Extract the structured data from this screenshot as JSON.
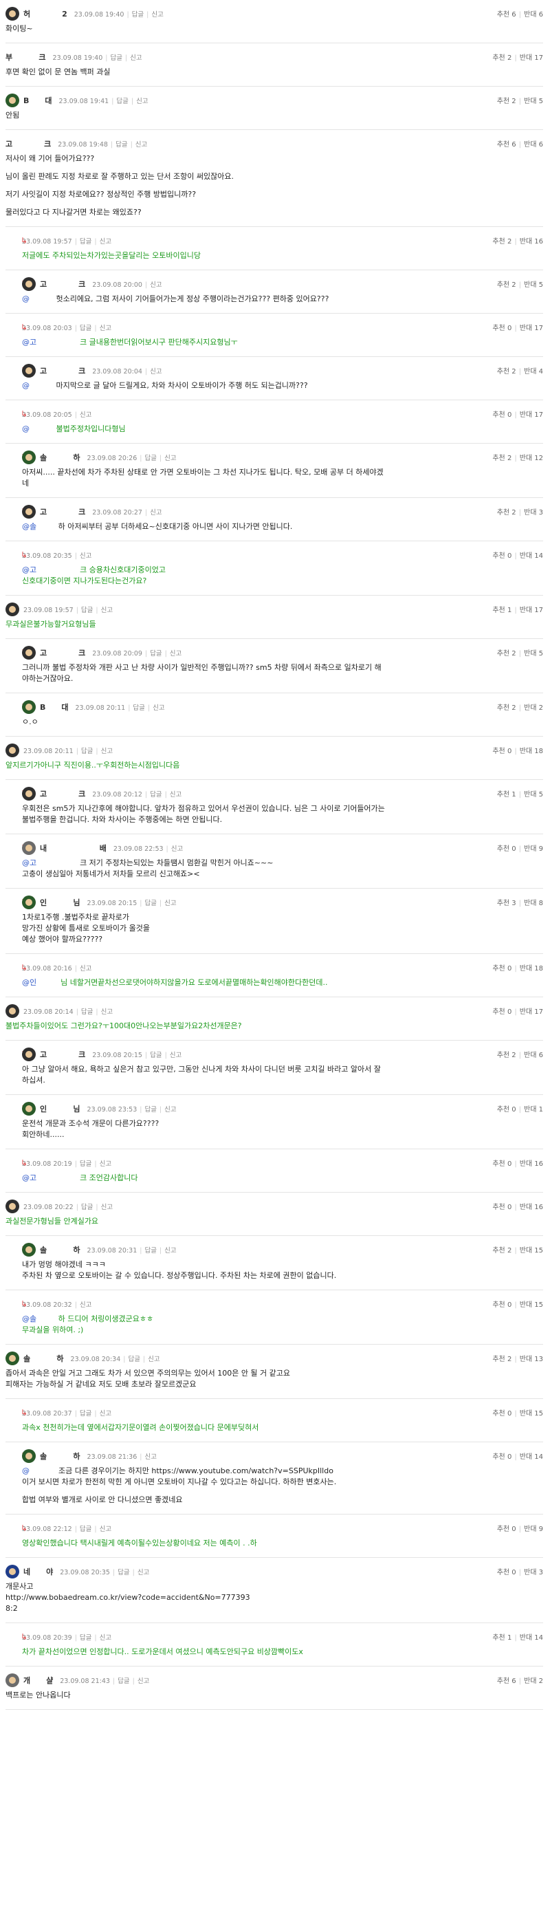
{
  "labels": {
    "reply": "답글",
    "report": "신고",
    "up": "추천",
    "down": "반대"
  },
  "comments": [
    {
      "id": 0,
      "reply": false,
      "avatar": "a1",
      "nick": "허            2",
      "date": "23.09.08 19:40",
      "links": [
        "답글",
        "신고"
      ],
      "up": "추천 6",
      "down": "반대 6",
      "lines": [
        "화이팅~"
      ]
    },
    {
      "id": 1,
      "reply": false,
      "avatar": "none",
      "nick": "부          크",
      "date": "23.09.08 19:40",
      "links": [
        "답글",
        "신고"
      ],
      "up": "추천 2",
      "down": "반대 17",
      "lines": [
        "후면 확인 없이 문 연놈 백퍼 과실"
      ]
    },
    {
      "id": 2,
      "reply": false,
      "avatar": "a2",
      "nick": "B      대",
      "date": "23.09.08 19:41",
      "links": [
        "답글",
        "신고"
      ],
      "up": "추천 2",
      "down": "반대 5",
      "lines": [
        "안됨"
      ]
    },
    {
      "id": 3,
      "reply": false,
      "avatar": "none",
      "nick": "고            크",
      "date": "23.09.08 19:48",
      "links": [
        "답글",
        "신고"
      ],
      "up": "추천 6",
      "down": "반대 6",
      "lines": [
        "저사이 왜 기어 들어가요???",
        "",
        "님이 올린 판례도 지정 차로로 잘 주행하고 있는 단서 조항이 써있잖아요.",
        "",
        "저기 사잇길이 지정 차로에요?? 정상적인 주행 방법입니까??",
        "",
        "물러있다고 다 지나갈거면 차로는 왜있죠??"
      ]
    },
    {
      "id": 4,
      "reply": true,
      "avatar": "none",
      "nick": "",
      "date": "23.09.08 19:57",
      "links": [
        "답글",
        "신고"
      ],
      "up": "추천 2",
      "down": "반대 16",
      "color": "green",
      "lines": [
        "저글에도 주차되있는차가있는곳을달리는 오토바이입니당"
      ]
    },
    {
      "id": 5,
      "reply": true,
      "avatar": "a1",
      "nick": "고            크",
      "date": "23.09.08 20:00",
      "links": [
        "신고"
      ],
      "up": "추천 2",
      "down": "반대 5",
      "mention": "@",
      "lines": [
        "           헛소리에요, 그럼 저사이 기어들어가는게 정상 주행이라는건가요??? 편하중 있어요???"
      ]
    },
    {
      "id": 6,
      "reply": true,
      "avatar": "none",
      "nick": "",
      "date": "23.09.08 20:03",
      "links": [
        "답글",
        "신고"
      ],
      "up": "추천 0",
      "down": "반대 17",
      "color": "green",
      "mention": "@고",
      "lines": [
        "                  크 글내용한번더읽어보시구 판단해주시지요형님ㅜ"
      ]
    },
    {
      "id": 7,
      "reply": true,
      "avatar": "a1",
      "nick": "고            크",
      "date": "23.09.08 20:04",
      "links": [
        "신고"
      ],
      "up": "추천 2",
      "down": "반대 4",
      "mention": "@",
      "lines": [
        "           마지막으로 글 달아 드릴게요, 차와 차사이 오토바이가 주행 허도 되는겁니까???"
      ]
    },
    {
      "id": 8,
      "reply": true,
      "avatar": "none",
      "nick": "",
      "date": "23.09.08 20:05",
      "links": [
        "신고"
      ],
      "up": "추천 0",
      "down": "반대 17",
      "color": "green",
      "mention": "@",
      "lines": [
        "           불법주정차입니다형님"
      ]
    },
    {
      "id": 9,
      "reply": true,
      "avatar": "a2",
      "nick": "솔          하",
      "date": "23.09.08 20:26",
      "links": [
        "답글",
        "신고"
      ],
      "up": "추천 2",
      "down": "반대 12",
      "lines": [
        "아저씨..... 끝차선에 차가 주차된 상태로 안 가면 오토바이는 그 차선 지나가도 됩니다. 탁오, 모배 공부 더 하세야겠",
        "네"
      ]
    },
    {
      "id": 10,
      "reply": true,
      "avatar": "a1",
      "nick": "고            크",
      "date": "23.09.08 20:27",
      "links": [
        "신고"
      ],
      "up": "추천 2",
      "down": "반대 3",
      "mention": "@솔",
      "lines": [
        "         하 아저씨부터 공부 더하세요~신호대기중 아니면 사이 지나가면 안됩니다."
      ]
    },
    {
      "id": 11,
      "reply": true,
      "avatar": "none",
      "nick": "",
      "date": "23.09.08 20:35",
      "links": [
        "신고"
      ],
      "up": "추천 0",
      "down": "반대 14",
      "color": "green",
      "mention": "@고",
      "lines": [
        "                  크 승용차신호대기중이었고",
        "신호대기중이면 지나가도된다는건가요?"
      ]
    },
    {
      "id": 12,
      "reply": false,
      "avatar": "a1",
      "nick": "",
      "date": "23.09.08 19:57",
      "links": [
        "답글",
        "신고"
      ],
      "up": "추천 1",
      "down": "반대 17",
      "color": "green",
      "lines": [
        "무과실은불가능할거요형님들"
      ]
    },
    {
      "id": 13,
      "reply": true,
      "avatar": "a1",
      "nick": "고            크",
      "date": "23.09.08 20:09",
      "links": [
        "답글",
        "신고"
      ],
      "up": "추천 2",
      "down": "반대 5",
      "lines": [
        "그러니까 불법 주정차와 개판 사고 난 차량 사이가 일반적인 주행입니까?? sm5 차량 뒤에서 좌측으로 일차로기 해",
        "야하는거잖아요."
      ]
    },
    {
      "id": 14,
      "reply": true,
      "avatar": "a2",
      "nick": "B      대",
      "date": "23.09.08 20:11",
      "links": [
        "답글",
        "신고"
      ],
      "up": "추천 2",
      "down": "반대 2",
      "lines": [
        "ㅇ.ㅇ"
      ]
    },
    {
      "id": 15,
      "reply": false,
      "avatar": "a1",
      "nick": "",
      "date": "23.09.08 20:11",
      "links": [
        "답글",
        "신고"
      ],
      "up": "추천 0",
      "down": "반대 18",
      "color": "green",
      "lines": [
        "앞지르기가아니구 직진이용..ㅜ우회전하는시점입니다음"
      ]
    },
    {
      "id": 16,
      "reply": true,
      "avatar": "a1",
      "nick": "고            크",
      "date": "23.09.08 20:12",
      "links": [
        "답글",
        "신고"
      ],
      "up": "추천 1",
      "down": "반대 5",
      "lines": [
        "우회전은 sm5가 지나간후에 해야합니다. 앞차가 점유하고 있어서 우선권이 있습니다. 님은 그 사이로 기어들어가는",
        "불법주행을 한겁니다. 차와 차사이는 주행중에는 하면 안됩니다."
      ]
    },
    {
      "id": 17,
      "reply": true,
      "avatar": "a4",
      "nick": "내                    배",
      "date": "23.09.08 22:53",
      "links": [
        "신고"
      ],
      "up": "추천 0",
      "down": "반대 9",
      "mention": "@고",
      "lines": [
        "                  크 저기 주정차는되있는 차들땜시 멈환길 막힌거 아니죠~~~",
        "고충이 생심일아 저통네가서 저차들 모르리 신고해죠><"
      ]
    },
    {
      "id": 18,
      "reply": true,
      "avatar": "a2",
      "nick": "인          님",
      "date": "23.09.08 20:15",
      "links": [
        "답글",
        "신고"
      ],
      "up": "추천 3",
      "down": "반대 8",
      "lines": [
        "1차로1주행 .불법주차로 끝차로가",
        "망가진 상황에 틈새로 오토바이가 올것을",
        "예상 했어야 할까요?????"
      ]
    },
    {
      "id": 19,
      "reply": true,
      "avatar": "none",
      "nick": "",
      "date": "23.09.08 20:16",
      "links": [
        "신고"
      ],
      "up": "추천 0",
      "down": "반대 18",
      "color": "green",
      "mention": "@인",
      "lines": [
        "          님 네할거면끝차선으로댓어야하지않을가요 도로에서끝멸매하는확인해야한다한던데.."
      ]
    },
    {
      "id": 20,
      "reply": false,
      "avatar": "a1",
      "nick": "",
      "date": "23.09.08 20:14",
      "links": [
        "답글",
        "신고"
      ],
      "up": "추천 0",
      "down": "반대 17",
      "color": "green",
      "lines": [
        "불법주차들이있어도 그런가요?ㅜ100대0안나오는부분일가요2차선개문은?"
      ]
    },
    {
      "id": 21,
      "reply": true,
      "avatar": "a1",
      "nick": "고            크",
      "date": "23.09.08 20:15",
      "links": [
        "답글",
        "신고"
      ],
      "up": "추천 2",
      "down": "반대 6",
      "lines": [
        "아 그냥 알아서 해요, 욕하고 싶은거 참고 있구만, 그동안 신나게 차와 차사이 다니던 버릇 고치길 바라고 알아서 잘",
        "하십셔."
      ]
    },
    {
      "id": 22,
      "reply": true,
      "avatar": "a2",
      "nick": "인          님",
      "date": "23.09.08 23:53",
      "links": [
        "답글",
        "신고"
      ],
      "up": "추천 0",
      "down": "반대 1",
      "lines": [
        "운전석 개문과 조수석 개문이 다른가요????",
        "회안하네......"
      ]
    },
    {
      "id": 23,
      "reply": true,
      "avatar": "none",
      "nick": "",
      "date": "23.09.08 20:19",
      "links": [
        "답글",
        "신고"
      ],
      "up": "추천 0",
      "down": "반대 16",
      "color": "green",
      "mention": "@고",
      "lines": [
        "                  크 조언감사합니다"
      ]
    },
    {
      "id": 24,
      "reply": false,
      "avatar": "a1",
      "nick": "",
      "date": "23.09.08 20:22",
      "links": [
        "답글",
        "신고"
      ],
      "up": "추천 0",
      "down": "반대 16",
      "color": "green",
      "lines": [
        "과실전문가형님들 안계실가요"
      ]
    },
    {
      "id": 25,
      "reply": true,
      "avatar": "a2",
      "nick": "솔          하",
      "date": "23.09.08 20:31",
      "links": [
        "답글",
        "신고"
      ],
      "up": "추천 2",
      "down": "반대 15",
      "lines": [
        "내가 멍멍 해야겠네 ㅋㅋㅋ",
        "주차된 차 옆으로 오토바이는 갈 수 있습니다. 정상주행입니다. 주차된 차는 차로에 권한이 없습니다."
      ]
    },
    {
      "id": 26,
      "reply": true,
      "avatar": "none",
      "nick": "",
      "date": "23.09.08 20:32",
      "links": [
        "신고"
      ],
      "up": "추천 0",
      "down": "반대 15",
      "color": "green",
      "mention": "@솔",
      "lines": [
        "         하 드디어 처링이생겼군요ㅎㅎ",
        "무과실을 위하여. ;)"
      ]
    },
    {
      "id": 27,
      "reply": false,
      "avatar": "a2",
      "nick": "솔          하",
      "date": "23.09.08 20:34",
      "links": [
        "답글",
        "신고"
      ],
      "up": "추천 2",
      "down": "반대 13",
      "lines": [
        "좁아서 과속은 안일 거고 그래도 차가 서 있으면 주의의무는 있어서 100은 안 될 거 같고요",
        "피해자는 가능하실 거 같네요 저도 모배 초보라 잘모르겠군요"
      ]
    },
    {
      "id": 28,
      "reply": true,
      "avatar": "none",
      "nick": "",
      "date": "23.09.08 20:37",
      "links": [
        "답글",
        "신고"
      ],
      "up": "추천 0",
      "down": "반대 15",
      "color": "green",
      "lines": [
        "과속x 천천히가는데 옆에서갑자기문이열려 손이찢어졌습니다 문에부딪혀서"
      ]
    },
    {
      "id": 29,
      "reply": true,
      "avatar": "a2",
      "nick": "솔          하",
      "date": "23.09.08 21:36",
      "links": [
        "신고"
      ],
      "up": "추천 0",
      "down": "반대 14",
      "mention": "@",
      "lines": [
        "            조금 다른 경우이기는 하지만 https://www.youtube.com/watch?v=SSPUkpIlldo",
        "이거 보시면 차로가 한전히 막힌 게 아니면 오토바이 지나갈 수 있다고는 하십니다. 하하한 변호사는.",
        "",
        "합법 여부와 별개로 사이로 안 다니셨으면 좋겠네요"
      ]
    },
    {
      "id": 30,
      "reply": true,
      "avatar": "none",
      "nick": "",
      "date": "23.09.08 22:12",
      "links": [
        "답글",
        "신고"
      ],
      "up": "추천 0",
      "down": "반대 9",
      "color": "green",
      "lines": [
        "영상확인했습니다 택시내릴게 예측이될수있는상황이네요 저는 예측이 . .하"
      ]
    },
    {
      "id": 31,
      "reply": false,
      "avatar": "a3",
      "nick": "네      야",
      "date": "23.09.08 20:35",
      "links": [
        "답글",
        "신고"
      ],
      "up": "추천 0",
      "down": "반대 3",
      "lines": [
        "개문사고",
        "http://www.bobaedream.co.kr/view?code=accident&No=777393",
        "8:2"
      ]
    },
    {
      "id": 32,
      "reply": true,
      "avatar": "none",
      "nick": "",
      "date": "23.09.08 20:39",
      "links": [
        "답글",
        "신고"
      ],
      "up": "추천 1",
      "down": "반대 14",
      "color": "green",
      "lines": [
        "차가 끝차선이었으면 인정합니다.. 도로가운데서 여셨으니 예측도안되구요 비상깜빡이도x"
      ]
    },
    {
      "id": 33,
      "reply": false,
      "avatar": "a4",
      "nick": "개      샬",
      "date": "23.09.08 21:43",
      "links": [
        "답글",
        "신고"
      ],
      "up": "추천 6",
      "down": "반대 2",
      "lines": [
        "백프로는 안나옵니다"
      ]
    }
  ]
}
